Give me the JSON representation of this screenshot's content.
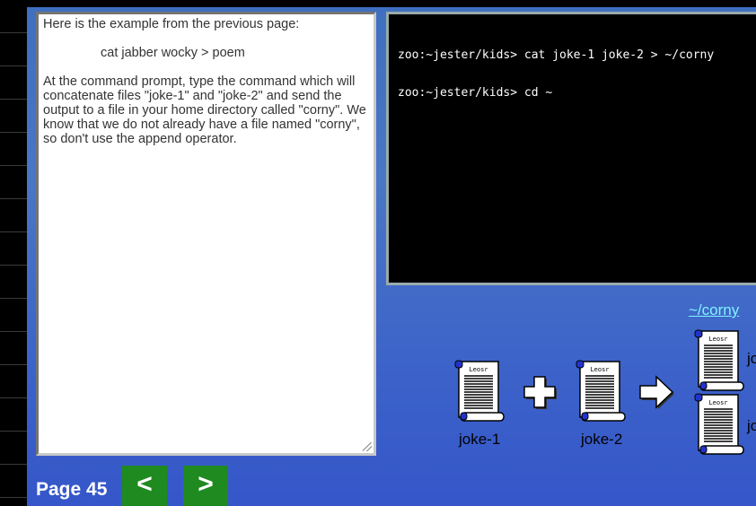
{
  "instructions": {
    "intro": "Here is the example from the previous page:",
    "example_command": "cat jabber wocky > poem",
    "task": "At the command prompt, type the command which will concatenate files \"joke-1\" and \"joke-2\" and send the output to a file in your home directory called \"corny\". We know that we do not already have a file named \"corny\", so don't use the append operator."
  },
  "terminal": {
    "lines": [
      "zoo:~jester/kids> cat joke-1 joke-2 > ~/corny",
      "zoo:~jester/kids> cd ~"
    ]
  },
  "diagram": {
    "source_files": [
      "joke-1",
      "joke-2"
    ],
    "output_file": "~/corny",
    "scroll_header": "Leosr",
    "cut_off_label": "jo"
  },
  "footer": {
    "page_label": "Page 45",
    "prev_label": "<",
    "next_label": ">"
  },
  "colors": {
    "background": "#3d64c9",
    "nav_button": "#1f8a1f",
    "link": "#7ff3ff",
    "terminal_bg": "#000000"
  },
  "icons": [
    "scroll-document-icon",
    "plus-icon",
    "right-arrow-icon",
    "resize-grip-icon"
  ]
}
